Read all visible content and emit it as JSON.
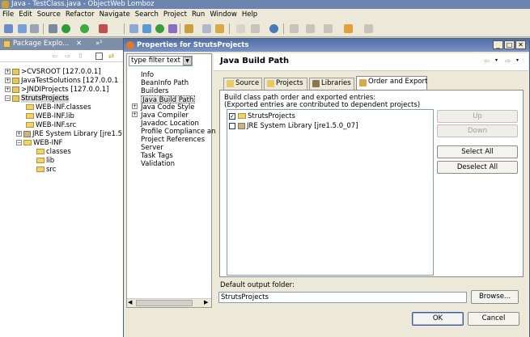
{
  "window": {
    "title": "Java - TestClass.java - ObjectWeb Lomboz"
  },
  "menu": [
    "File",
    "Edit",
    "Source",
    "Refactor",
    "Navigate",
    "Search",
    "Project",
    "Run",
    "Window",
    "Help"
  ],
  "package_explorer": {
    "tab_label": "Package Explo...",
    "extra": "»¹",
    "items": [
      {
        "label": ">CVSROOT  [127.0.0.1]",
        "level": 0,
        "kind": "project",
        "expander": "+"
      },
      {
        "label": "JavaTestSolutions  [127.0.0.1",
        "level": 0,
        "kind": "project",
        "expander": "+"
      },
      {
        "label": ">JNDIProjects  [127.0.0.1]",
        "level": 0,
        "kind": "project",
        "expander": "+"
      },
      {
        "label": "StrutsProjects",
        "level": 0,
        "kind": "project",
        "expander": "−",
        "selected": true
      },
      {
        "label": "WEB-INF.classes",
        "level": 1,
        "kind": "folder",
        "expander": ""
      },
      {
        "label": "WEB-INF.lib",
        "level": 1,
        "kind": "folder",
        "expander": ""
      },
      {
        "label": "WEB-INF.src",
        "level": 1,
        "kind": "folder",
        "expander": ""
      },
      {
        "label": "JRE System Library [jre1.5",
        "level": 1,
        "kind": "jar",
        "expander": "+"
      },
      {
        "label": "WEB-INF",
        "level": 1,
        "kind": "folder",
        "expander": "−"
      },
      {
        "label": "classes",
        "level": 2,
        "kind": "folder",
        "expander": ""
      },
      {
        "label": "lib",
        "level": 2,
        "kind": "folder",
        "expander": ""
      },
      {
        "label": "src",
        "level": 2,
        "kind": "folder",
        "expander": ""
      }
    ]
  },
  "dialog": {
    "title": "Properties for StrutsProjects",
    "filter_value": "type filter text",
    "nav": [
      {
        "label": "Info",
        "expander": ""
      },
      {
        "label": "BeanInfo Path",
        "expander": ""
      },
      {
        "label": "Builders",
        "expander": ""
      },
      {
        "label": "Java Build Path",
        "expander": "",
        "selected": true
      },
      {
        "label": "Java Code Style",
        "expander": "+"
      },
      {
        "label": "Java Compiler",
        "expander": "+"
      },
      {
        "label": "Javadoc Location",
        "expander": ""
      },
      {
        "label": "Profile Compliance an",
        "expander": ""
      },
      {
        "label": "Project References",
        "expander": ""
      },
      {
        "label": "Server",
        "expander": ""
      },
      {
        "label": "Task Tags",
        "expander": ""
      },
      {
        "label": "Validation",
        "expander": ""
      }
    ],
    "page_title": "Java Build Path",
    "tabs": [
      {
        "label": "Source",
        "active": false
      },
      {
        "label": "Projects",
        "active": false
      },
      {
        "label": "Libraries",
        "active": false
      },
      {
        "label": "Order and Export",
        "active": true
      }
    ],
    "desc_line1": "Build class path order and exported entries:",
    "desc_line2": "(Exported entries are contributed to dependent projects)",
    "entries": [
      {
        "label": "StrutsProjects",
        "checked": true,
        "kind": "folder"
      },
      {
        "label": "JRE System Library [jre1.5.0_07]",
        "checked": false,
        "kind": "jar"
      }
    ],
    "buttons": {
      "up": "Up",
      "down": "Down",
      "select_all": "Select All",
      "deselect_all": "Deselect All"
    },
    "output_label": "Default output folder:",
    "output_value": "StrutsProjects",
    "browse": "Browse...",
    "ok": "OK",
    "cancel": "Cancel"
  }
}
